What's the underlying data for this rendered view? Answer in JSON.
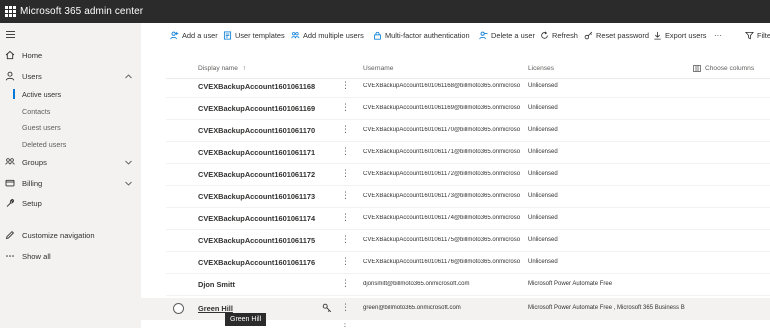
{
  "app": {
    "title": "Microsoft 365 admin center"
  },
  "sidebar": {
    "items": [
      {
        "label": "Home",
        "icon": "home-icon"
      },
      {
        "label": "Users",
        "icon": "user-icon"
      },
      {
        "label": "Groups",
        "icon": "groups-icon"
      },
      {
        "label": "Billing",
        "icon": "billing-icon"
      },
      {
        "label": "Setup",
        "icon": "wrench-icon"
      },
      {
        "label": "Customize navigation",
        "icon": "pencil-icon"
      },
      {
        "label": "Show all",
        "icon": "ellipsis-icon"
      }
    ],
    "users_sub": [
      {
        "label": "Active users"
      },
      {
        "label": "Contacts"
      },
      {
        "label": "Guest users"
      },
      {
        "label": "Deleted users"
      }
    ]
  },
  "toolbar": {
    "add_user": "Add a user",
    "user_templates": "User templates",
    "add_multiple": "Add multiple users",
    "mfa": "Multi-factor authentication",
    "delete_user": "Delete a user",
    "refresh": "Refresh",
    "reset_password": "Reset password",
    "export_users": "Export users",
    "more": "···",
    "filter": "Filte"
  },
  "table": {
    "headers": {
      "display_name": "Display name",
      "sort_arrow": "↑",
      "username": "Username",
      "licenses": "Licenses",
      "choose_columns": "Choose columns"
    },
    "rows": [
      {
        "name": "CVEXBackupAccount1601061168",
        "username": "CVEXBackupAccount1601061168@billmoto365.onmicroso",
        "license": "Unlicensed"
      },
      {
        "name": "CVEXBackupAccount1601061169",
        "username": "CVEXBackupAccount1601061169@billmoto365.onmicroso",
        "license": "Unlicensed"
      },
      {
        "name": "CVEXBackupAccount1601061170",
        "username": "CVEXBackupAccount1601061170@billmoto365.onmicroso",
        "license": "Unlicensed"
      },
      {
        "name": "CVEXBackupAccount1601061171",
        "username": "CVEXBackupAccount1601061171@billmoto365.onmicroso",
        "license": "Unlicensed"
      },
      {
        "name": "CVEXBackupAccount1601061172",
        "username": "CVEXBackupAccount1601061172@billmoto365.onmicroso",
        "license": "Unlicensed"
      },
      {
        "name": "CVEXBackupAccount1601061173",
        "username": "CVEXBackupAccount1601061173@billmoto365.onmicroso",
        "license": "Unlicensed"
      },
      {
        "name": "CVEXBackupAccount1601061174",
        "username": "CVEXBackupAccount1601061174@billmoto365.onmicroso",
        "license": "Unlicensed"
      },
      {
        "name": "CVEXBackupAccount1601061175",
        "username": "CVEXBackupAccount1601061175@billmoto365.onmicroso",
        "license": "Unlicensed"
      },
      {
        "name": "CVEXBackupAccount1601061176",
        "username": "CVEXBackupAccount1601061176@billmoto365.onmicroso",
        "license": "Unlicensed"
      },
      {
        "name": "Djon Smitt",
        "username": "djonsmitt@billmoto365.onmicrosoft.com",
        "license": "Microsoft Power Automate Free"
      },
      {
        "name": "Green Hill",
        "username": "green@billmoto365.onmicrosoft.com",
        "license": "Microsoft Power Automate Free , Microsoft 365 Business B"
      }
    ],
    "row_more": "⋮"
  },
  "tooltip": {
    "text": "Green Hill"
  },
  "colors": {
    "topbar": "#2b2b2b",
    "sidebar": "#f3f2f1",
    "accent": "#0078d4"
  }
}
